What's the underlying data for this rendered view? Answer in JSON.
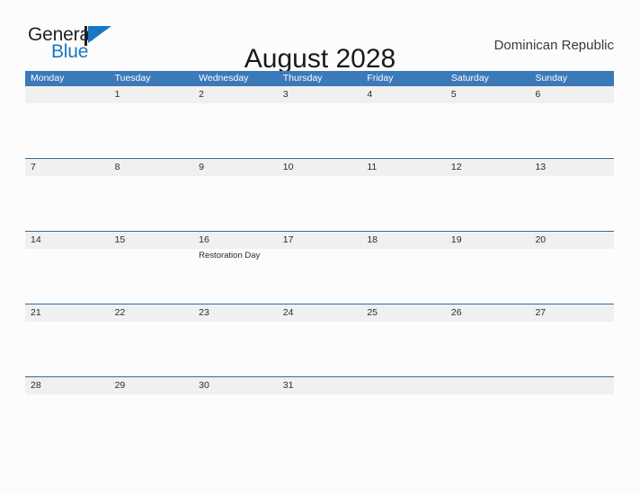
{
  "logo": {
    "text_top": "General",
    "text_bottom": "Blue",
    "flag_icon": "blue-flag-triangle-icon",
    "brand_blue": "#1877c4",
    "brand_dark": "#231f20"
  },
  "header": {
    "title": "August 2028",
    "region": "Dominican Republic"
  },
  "theme": {
    "header_blue": "#3b79b9",
    "row_divider_blue": "#2e6da4",
    "band_gray": "#f0f0f0",
    "page_background": "#fcfcfc",
    "text_dark": "#2a2a2a"
  },
  "calendar": {
    "month": "August",
    "year": "2028",
    "weekday_headers": [
      "Monday",
      "Tuesday",
      "Wednesday",
      "Thursday",
      "Friday",
      "Saturday",
      "Sunday"
    ],
    "weeks": [
      [
        {
          "date": ""
        },
        {
          "date": "1"
        },
        {
          "date": "2"
        },
        {
          "date": "3"
        },
        {
          "date": "4"
        },
        {
          "date": "5"
        },
        {
          "date": "6"
        }
      ],
      [
        {
          "date": "7"
        },
        {
          "date": "8"
        },
        {
          "date": "9"
        },
        {
          "date": "10"
        },
        {
          "date": "11"
        },
        {
          "date": "12"
        },
        {
          "date": "13"
        }
      ],
      [
        {
          "date": "14"
        },
        {
          "date": "15"
        },
        {
          "date": "16",
          "event": "Restoration Day"
        },
        {
          "date": "17"
        },
        {
          "date": "18"
        },
        {
          "date": "19"
        },
        {
          "date": "20"
        }
      ],
      [
        {
          "date": "21"
        },
        {
          "date": "22"
        },
        {
          "date": "23"
        },
        {
          "date": "24"
        },
        {
          "date": "25"
        },
        {
          "date": "26"
        },
        {
          "date": "27"
        }
      ],
      [
        {
          "date": "28"
        },
        {
          "date": "29"
        },
        {
          "date": "30"
        },
        {
          "date": "31"
        },
        {
          "date": ""
        },
        {
          "date": ""
        },
        {
          "date": ""
        }
      ]
    ],
    "holidays": [
      {
        "date": "16",
        "name": "Restoration Day"
      }
    ]
  }
}
